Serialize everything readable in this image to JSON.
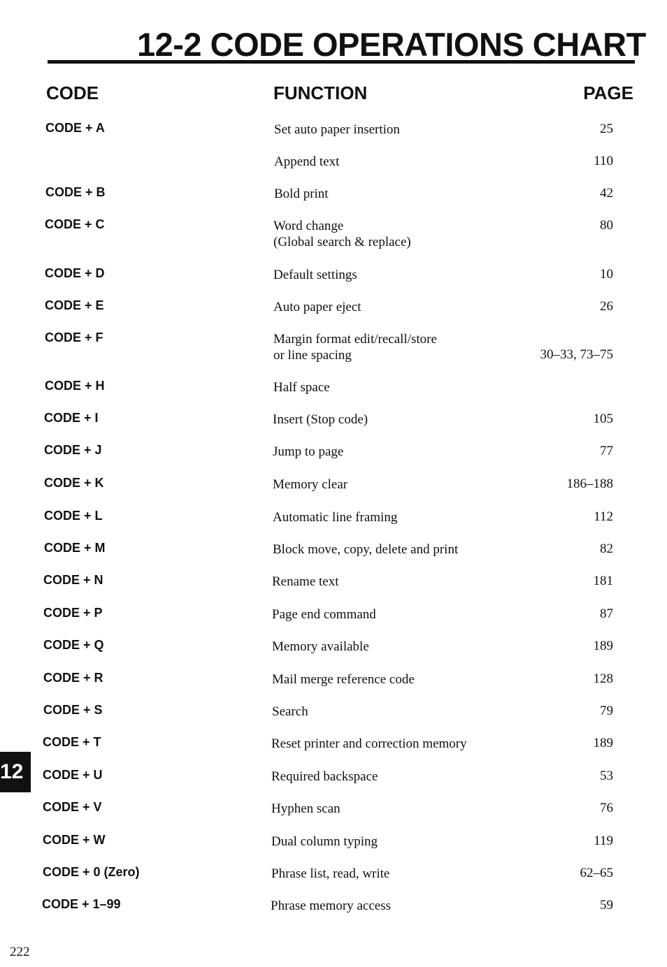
{
  "title": "12-2  CODE OPERATIONS CHART",
  "headers": {
    "code": "CODE",
    "function": "FUNCTION",
    "page": "PAGE"
  },
  "rows": [
    {
      "code": "CODE + A",
      "function": "Set auto paper insertion",
      "page": "25"
    },
    {
      "code": "",
      "function": "Append text",
      "page": "110"
    },
    {
      "code": "CODE + B",
      "function": "Bold print",
      "page": "42"
    },
    {
      "code": "CODE + C",
      "function": "Word change\n(Global search & replace)",
      "page": "80"
    },
    {
      "code": "CODE + D",
      "function": "Default settings",
      "page": "10"
    },
    {
      "code": "CODE + E",
      "function": "Auto paper eject",
      "page": "26"
    },
    {
      "code": "CODE + F",
      "function": "Margin format edit/recall/store\nor line spacing",
      "page": "30–33, 73–75"
    },
    {
      "code": "CODE + H",
      "function": "Half space",
      "page": ""
    },
    {
      "code": "CODE + I",
      "function": "Insert (Stop code)",
      "page": "105"
    },
    {
      "code": "CODE + J",
      "function": "Jump to page",
      "page": "77"
    },
    {
      "code": "CODE + K",
      "function": "Memory clear",
      "page": "186–188"
    },
    {
      "code": "CODE + L",
      "function": "Automatic line framing",
      "page": "112"
    },
    {
      "code": "CODE + M",
      "function": "Block move, copy, delete and print",
      "page": "82"
    },
    {
      "code": "CODE + N",
      "function": "Rename text",
      "page": "181"
    },
    {
      "code": "CODE + P",
      "function": "Page end command",
      "page": "87"
    },
    {
      "code": "CODE + Q",
      "function": "Memory available",
      "page": "189"
    },
    {
      "code": "CODE + R",
      "function": "Mail merge reference code",
      "page": "128"
    },
    {
      "code": "CODE + S",
      "function": "Search",
      "page": "79"
    },
    {
      "code": "CODE + T",
      "function": "Reset printer and correction memory",
      "page": "189"
    },
    {
      "code": "CODE + U",
      "function": "Required backspace",
      "page": "53"
    },
    {
      "code": "CODE + V",
      "function": "Hyphen scan",
      "page": "76"
    },
    {
      "code": "CODE + W",
      "function": "Dual column typing",
      "page": "119"
    },
    {
      "code": "CODE + 0 (Zero)",
      "function": "Phrase list, read, write",
      "page": "62–65"
    },
    {
      "code": "CODE + 1–99",
      "function": "Phrase memory access",
      "page": "59"
    }
  ],
  "chapter_tab": "12",
  "page_number": "222"
}
